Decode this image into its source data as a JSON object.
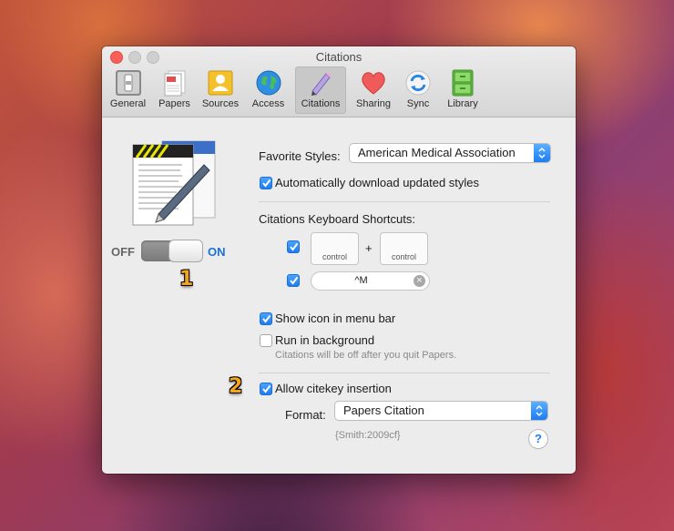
{
  "window": {
    "title": "Citations"
  },
  "toolbar": {
    "items": [
      {
        "label": "General",
        "icon": "switch-icon"
      },
      {
        "label": "Papers",
        "icon": "papers-icon"
      },
      {
        "label": "Sources",
        "icon": "sources-icon"
      },
      {
        "label": "Access",
        "icon": "globe-icon"
      },
      {
        "label": "Citations",
        "icon": "pen-icon",
        "selected": true
      },
      {
        "label": "Sharing",
        "icon": "heart-icon"
      },
      {
        "label": "Sync",
        "icon": "sync-icon"
      },
      {
        "label": "Library",
        "icon": "cabinet-icon"
      }
    ]
  },
  "left_panel": {
    "off_label": "OFF",
    "on_label": "ON",
    "toggle_state": "on",
    "annotation_1": "1"
  },
  "favorite_styles": {
    "label": "Favorite Styles:",
    "value": "American Medical Association"
  },
  "auto_download": {
    "label": "Automatically download updated styles",
    "checked": true
  },
  "shortcuts": {
    "label": "Citations Keyboard Shortcuts:",
    "key1": "control",
    "plus": "+",
    "key2": "control",
    "shortcut_value": "^M",
    "clear_glyph": "×"
  },
  "show_icon": {
    "label": "Show icon in menu bar",
    "checked": true
  },
  "run_background": {
    "label": "Run in background",
    "checked": false,
    "note": "Citations will be off after you quit Papers."
  },
  "annotation_2": "2",
  "citekey": {
    "label": "Allow citekey insertion",
    "checked": true
  },
  "format": {
    "label": "Format:",
    "value": "Papers Citation",
    "example": "{Smith:2009cf}"
  },
  "help": {
    "glyph": "?"
  },
  "colors": {
    "accent": "#1d7cf2",
    "close": "#fc5f57",
    "annotation": "#f2a51c"
  }
}
